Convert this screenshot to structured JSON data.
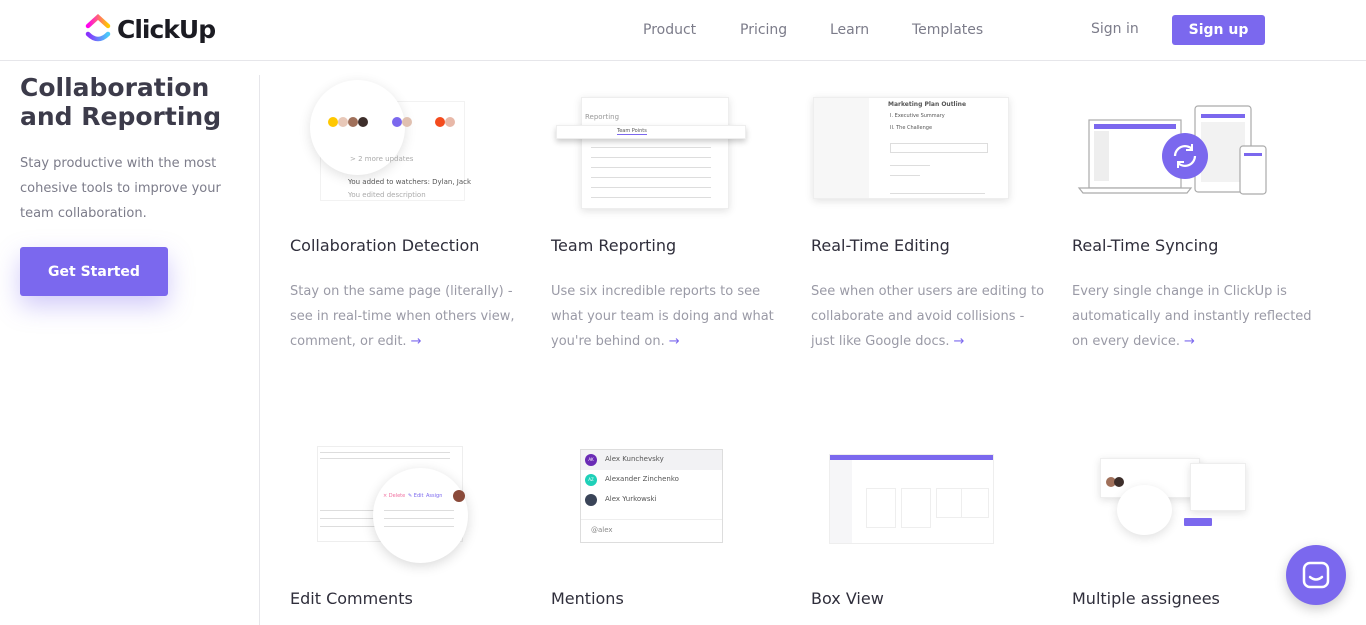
{
  "header": {
    "logo_text": "ClickUp",
    "nav": [
      "Product",
      "Pricing",
      "Learn",
      "Templates"
    ],
    "sign_in": "Sign in",
    "sign_up": "Sign up"
  },
  "hero": {
    "title": "Collaboration and Reporting",
    "description": "Stay productive with the most cohesive tools to improve your team collaboration.",
    "cta": "Get Started"
  },
  "colors": {
    "accent": "#7b68ee"
  },
  "features": [
    {
      "title": "Collaboration Detection",
      "description": "Stay on the same page (literally) - see in real-time when others view, comment, or edit."
    },
    {
      "title": "Team Reporting",
      "description": "Use six incredible reports to see what your team is doing and what you're behind on."
    },
    {
      "title": "Real-Time Editing",
      "description": "See when other users are editing to collaborate and avoid collisions - just like Google docs."
    },
    {
      "title": "Real-Time Syncing",
      "description": "Every single change in ClickUp is automatically and instantly reflected on every device."
    },
    {
      "title": "Edit Comments"
    },
    {
      "title": "Mentions"
    },
    {
      "title": "Box View"
    },
    {
      "title": "Multiple assignees"
    }
  ],
  "illustrations": {
    "collab": {
      "more": "> 2 more updates",
      "watchers": "You added to watchers: Dylan, Jack",
      "edited": "You edited description"
    },
    "reporting": {
      "header": "Reporting",
      "tab": "Team Points"
    },
    "editing": {
      "doc_title": "Marketing Plan Outline",
      "section1": "I. Executive Summary",
      "section2": "II. The Challenge"
    },
    "comments": {
      "delete": "× Delete",
      "edit": "✎ Edit",
      "assign": "Assign"
    },
    "mentions": {
      "users": [
        "Alex Kunchevsky",
        "Alexander Zinchenko",
        "Alex Yurkowski"
      ],
      "initials": [
        "AK",
        "AZ",
        ""
      ],
      "input": "@alex"
    }
  }
}
